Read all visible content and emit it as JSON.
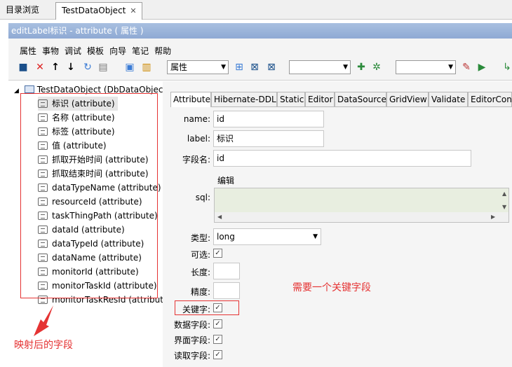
{
  "tabs": {
    "dir": "目录浏览",
    "obj": "TestDataObject",
    "close": "✕"
  },
  "title": "editLabel标识 - attribute ( 属性 )",
  "menu": [
    "属性",
    "事物",
    "调试",
    "模板",
    "向导",
    "笔记",
    "帮助"
  ],
  "toolbar": {
    "combo1": "属性",
    "combo2": "",
    "combo3": ""
  },
  "tree": {
    "root": "TestDataObject (DbDataObjec",
    "items": [
      "标识 (attribute)",
      "名称 (attribute)",
      "标签 (attribute)",
      "值 (attribute)",
      "抓取开始时间 (attribute)",
      "抓取结束时间 (attribute)",
      "dataTypeName (attribute)",
      "resourceId (attribute)",
      "taskThingPath (attribute)",
      "dataId (attribute)",
      "dataTypeId (attribute)",
      "dataName (attribute)",
      "monitorId (attribute)",
      "monitorTaskId (attribute)",
      "monitorTaskResId (attribut"
    ]
  },
  "editor_tabs": [
    "Attribute",
    "Hibernate-DDL",
    "Static",
    "Editor",
    "DataSource",
    "GridView",
    "Validate",
    "EditorCon"
  ],
  "form": {
    "name_label": "name:",
    "name_value": "id",
    "label_label": "label:",
    "label_value": "标识",
    "field_label": "字段名:",
    "field_value": "id",
    "edit_label": "编辑",
    "sql_label": "sql:",
    "type_label": "类型:",
    "type_value": "long",
    "nullable_label": "可选:",
    "length_label": "长度:",
    "precision_label": "精度:",
    "key_label": "关键字:",
    "data_label": "数据字段:",
    "ui_label": "界面字段:",
    "read_label": "读取字段:"
  },
  "annotations": {
    "mapped": "映射后的字段",
    "need_key": "需要一个关键字段"
  },
  "colors": {
    "red": "#e53333",
    "title": "#9ab3da"
  }
}
